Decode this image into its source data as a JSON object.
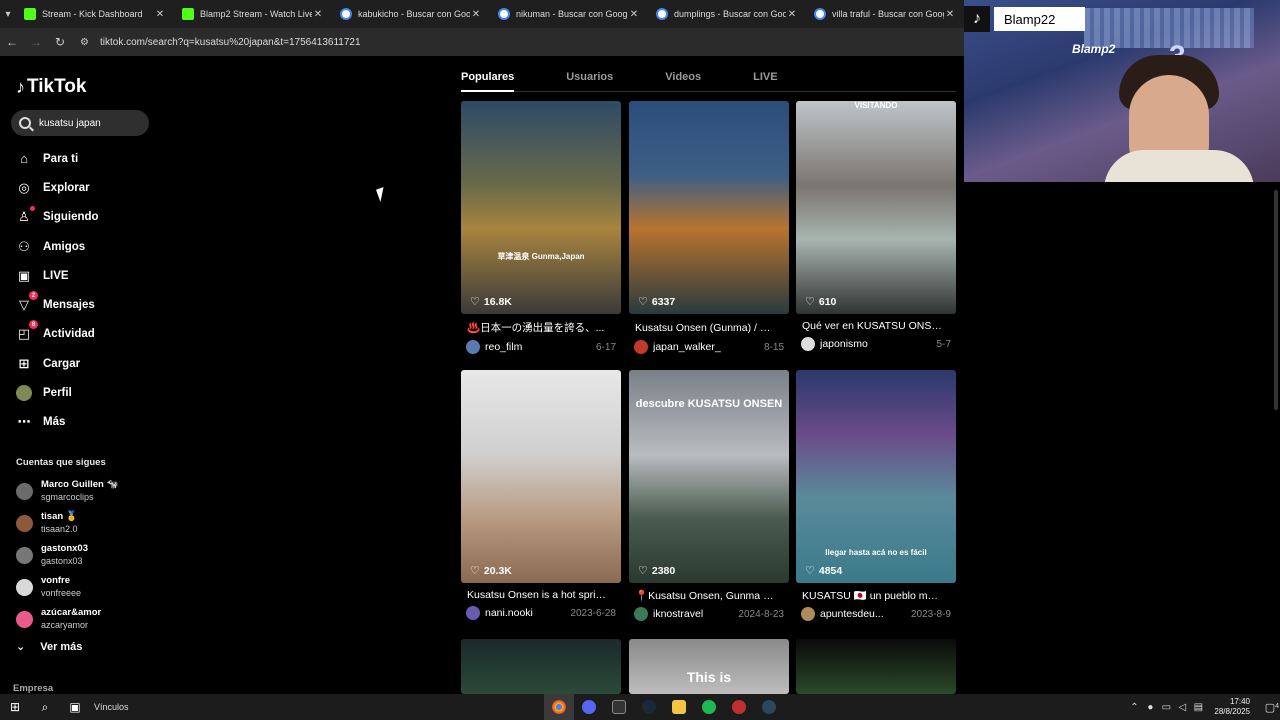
{
  "browser": {
    "tabs_menu_icon": "chevron-down-icon",
    "tabs": [
      {
        "title": "Stream - Kick Dashboard",
        "favicon": "kick"
      },
      {
        "title": "Blamp2 Stream - Watch Live on",
        "favicon": "kick"
      },
      {
        "title": "kabukicho - Buscar con Google",
        "favicon": "google"
      },
      {
        "title": "nikuman - Buscar con Google",
        "favicon": "google"
      },
      {
        "title": "dumplings - Buscar con Google",
        "favicon": "google"
      },
      {
        "title": "villa traful - Buscar con Google",
        "favicon": "google"
      }
    ],
    "url": "tiktok.com/search?q=kusatsu%20japan&t=1756413611721"
  },
  "webcam": {
    "channel_name": "Blamp22",
    "overlay_text": "Blamp2",
    "overlay_number": "3"
  },
  "tiktok": {
    "logo_text": "TikTok",
    "search_value": "kusatsu japan",
    "nav": [
      {
        "label": "Para ti",
        "icon": "home-icon"
      },
      {
        "label": "Explorar",
        "icon": "compass-icon"
      },
      {
        "label": "Siguiendo",
        "icon": "following-icon"
      },
      {
        "label": "Amigos",
        "icon": "friends-icon"
      },
      {
        "label": "LIVE",
        "icon": "live-icon"
      },
      {
        "label": "Mensajes",
        "icon": "messages-icon",
        "badge": "2"
      },
      {
        "label": "Actividad",
        "icon": "activity-icon",
        "badge": "8"
      },
      {
        "label": "Cargar",
        "icon": "upload-icon"
      },
      {
        "label": "Perfil",
        "icon": "profile-avatar"
      },
      {
        "label": "Más",
        "icon": "more-icon"
      }
    ],
    "following_heading": "Cuentas que sigues",
    "following": [
      {
        "name": "Marco Guillen 🐄",
        "handle": "sgmarcoclips",
        "color": "#6b6b6b"
      },
      {
        "name": "tisan 🏅",
        "handle": "tisaan2.0",
        "color": "#8a5a3a"
      },
      {
        "name": "gastonx03",
        "handle": "gastonx03",
        "color": "#777777"
      },
      {
        "name": "vonfre",
        "handle": "vonfreeee",
        "color": "#d9d9d9"
      },
      {
        "name": "azúcar&amor",
        "handle": "azcaryamor",
        "color": "#e85b8a"
      }
    ],
    "see_more": "Ver más",
    "company": "Empresa",
    "tabs": [
      "Populares",
      "Usuarios",
      "Videos",
      "LIVE"
    ],
    "videos": [
      {
        "likes": "16.8K",
        "title": "♨️日本一の湧出量を誇る、...",
        "user": "reo_film",
        "date": "6-17",
        "bg": "linear-gradient(180deg,#2d4a66 0%,#6b6a4a 40%,#a8843e 60%,#3a3a3a 100%)",
        "avatar": "#5a7ab0",
        "overlay": "草津温泉 Gunma,Japan"
      },
      {
        "likes": "6337",
        "title": "Kusatsu Onsen (Gunma) / 草...",
        "user": "japan_walker_",
        "date": "8-15",
        "bg": "linear-gradient(180deg,#2b4d7a 0%,#3d5f86 35%,#b8742e 60%,#2a3a3e 100%)",
        "avatar": "#c0392b",
        "overlay": ""
      },
      {
        "likes": "610",
        "title": "Qué ver en KUSATSU ONSE...",
        "user": "japonismo",
        "date": "5-7",
        "bg": "linear-gradient(180deg,#bfc4c8 0%,#7a7570 40%,#a8b4b0 65%,#303432 100%)",
        "avatar": "#dddddd",
        "overlay": "VISITANDO"
      },
      {
        "likes": "20.3K",
        "title": "Kusatsu Onsen is a hot sprin...",
        "user": "nani.nooki",
        "date": "2023-6-28",
        "bg": "linear-gradient(180deg,#e8e8e8 0%,#cfcfcf 40%,#b89a80 70%,#8a6a50 100%)",
        "avatar": "#6a5ab0",
        "overlay": ""
      },
      {
        "likes": "2380",
        "title": "📍Kusatsu Onsen, Gunma 🇯🇵",
        "user": "iknostravel",
        "date": "2024-8-23",
        "bg": "linear-gradient(180deg,#7a8088 0%,#b8bcc0 40%,#4a5a4e 70%,#2a3a30 100%)",
        "avatar": "#3a7a5a",
        "overlay": "descubre KUSATSU ONSEN"
      },
      {
        "likes": "4854",
        "title": "KUSATSU 🇯🇵 un pueblo mági...",
        "user": "apuntesdeu...",
        "date": "2023-8-9",
        "bg": "linear-gradient(180deg,#2a3a6a 0%,#6a4a8a 30%,#5a8a9a 60%,#3a7a8a 100%)",
        "avatar": "#b08a5a",
        "overlay": "llegar hasta acá no es fácil"
      },
      {
        "likes": "",
        "title": "",
        "user": "",
        "date": "",
        "bg": "linear-gradient(180deg,#1a2a2a 0%,#2a4a3a 100%)",
        "avatar": "",
        "overlay": ""
      },
      {
        "likes": "",
        "title": "",
        "user": "",
        "date": "",
        "bg": "linear-gradient(180deg,#8a8a8a 0%,#bdbdbd 100%)",
        "avatar": "",
        "overlay": "This is"
      },
      {
        "likes": "",
        "title": "",
        "user": "",
        "date": "",
        "bg": "linear-gradient(180deg,#0a0a0a 0%,#2a4a2a 100%)",
        "avatar": "",
        "overlay": ""
      }
    ]
  },
  "taskbar": {
    "links_label": "Vínculos",
    "time": "17:40",
    "date": "28/8/2025",
    "notifications": "4"
  }
}
